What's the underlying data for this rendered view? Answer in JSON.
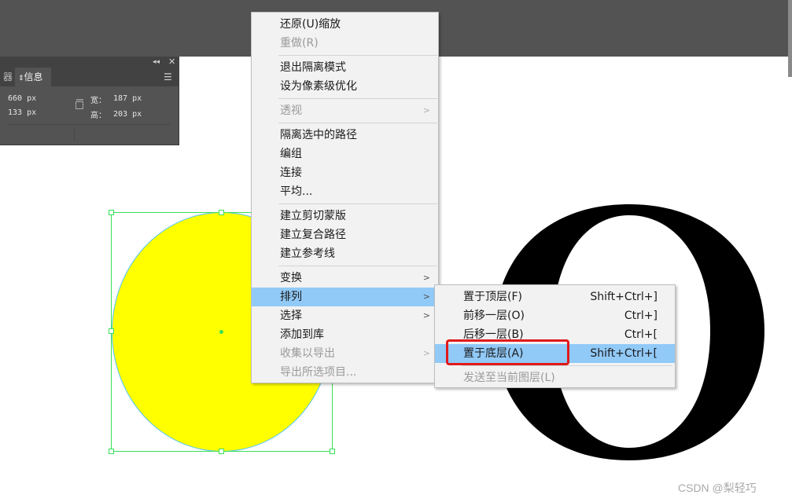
{
  "info_panel": {
    "collapse_icon": "double-chevron-left",
    "close_icon": "close-x",
    "prev_tab_label": "器",
    "active_tab_label": "信息",
    "x_value": "660 px",
    "y_value": "133 px",
    "width_label": "宽：",
    "width_value": "187 px",
    "height_label": "高：",
    "height_value": "203 px"
  },
  "canvas": {
    "circle_fill": "#ffff00",
    "selection_color": "#3adf58",
    "glyph": "O"
  },
  "context_menu": {
    "items": [
      {
        "label": "还原(U)缩放",
        "disabled": false
      },
      {
        "label": "重做(R)",
        "disabled": true
      },
      {
        "label": "退出隔离模式",
        "disabled": false
      },
      {
        "label": "设为像素级优化",
        "disabled": false
      },
      {
        "label": "透视",
        "disabled": true
      },
      {
        "label": "隔离选中的路径",
        "disabled": false
      },
      {
        "label": "编组",
        "disabled": false
      },
      {
        "label": "连接",
        "disabled": false
      },
      {
        "label": "平均...",
        "disabled": false
      },
      {
        "label": "建立剪切蒙版",
        "disabled": false
      },
      {
        "label": "建立复合路径",
        "disabled": false
      },
      {
        "label": "建立参考线",
        "disabled": false
      },
      {
        "label": "变换",
        "disabled": false
      },
      {
        "label": "排列",
        "disabled": false,
        "highlighted": true
      },
      {
        "label": "选择",
        "disabled": false
      },
      {
        "label": "添加到库",
        "disabled": false
      },
      {
        "label": "收集以导出",
        "disabled": true
      },
      {
        "label": "导出所选项目...",
        "disabled": true
      }
    ]
  },
  "submenu": {
    "items": [
      {
        "label": "置于顶层(F)",
        "shortcut": "Shift+Ctrl+]"
      },
      {
        "label": "前移一层(O)",
        "shortcut": "Ctrl+]"
      },
      {
        "label": "后移一层(B)",
        "shortcut": "Ctrl+["
      },
      {
        "label": "置于底层(A)",
        "shortcut": "Shift+Ctrl+[",
        "highlighted": true
      },
      {
        "label": "发送至当前图层(L)",
        "shortcut": "",
        "disabled": true
      }
    ]
  },
  "watermark": "CSDN @梨轻巧"
}
